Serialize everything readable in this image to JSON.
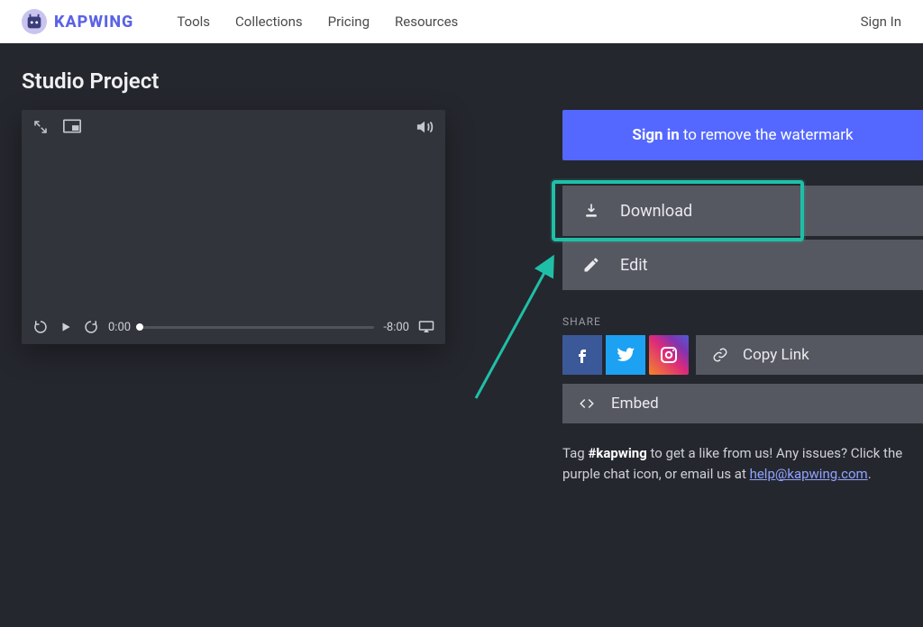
{
  "brand": {
    "text": "KAPWING"
  },
  "nav": {
    "links": [
      "Tools",
      "Collections",
      "Pricing",
      "Resources"
    ],
    "signin": "Sign In"
  },
  "page_title": "Studio Project",
  "player": {
    "current_time": "0:00",
    "remaining": "-8:00"
  },
  "cta": {
    "strong": "Sign in",
    "rest": " to remove the watermark"
  },
  "actions": {
    "download": "Download",
    "edit": "Edit"
  },
  "share": {
    "label": "SHARE",
    "copy": "Copy Link",
    "embed": "Embed"
  },
  "footer": {
    "pre": "Tag ",
    "hashtag": "#kapwing",
    "mid": " to get a like from us! Any issues? Click the purple chat icon, or email us at ",
    "email": "help@kapwing.com",
    "post": "."
  }
}
